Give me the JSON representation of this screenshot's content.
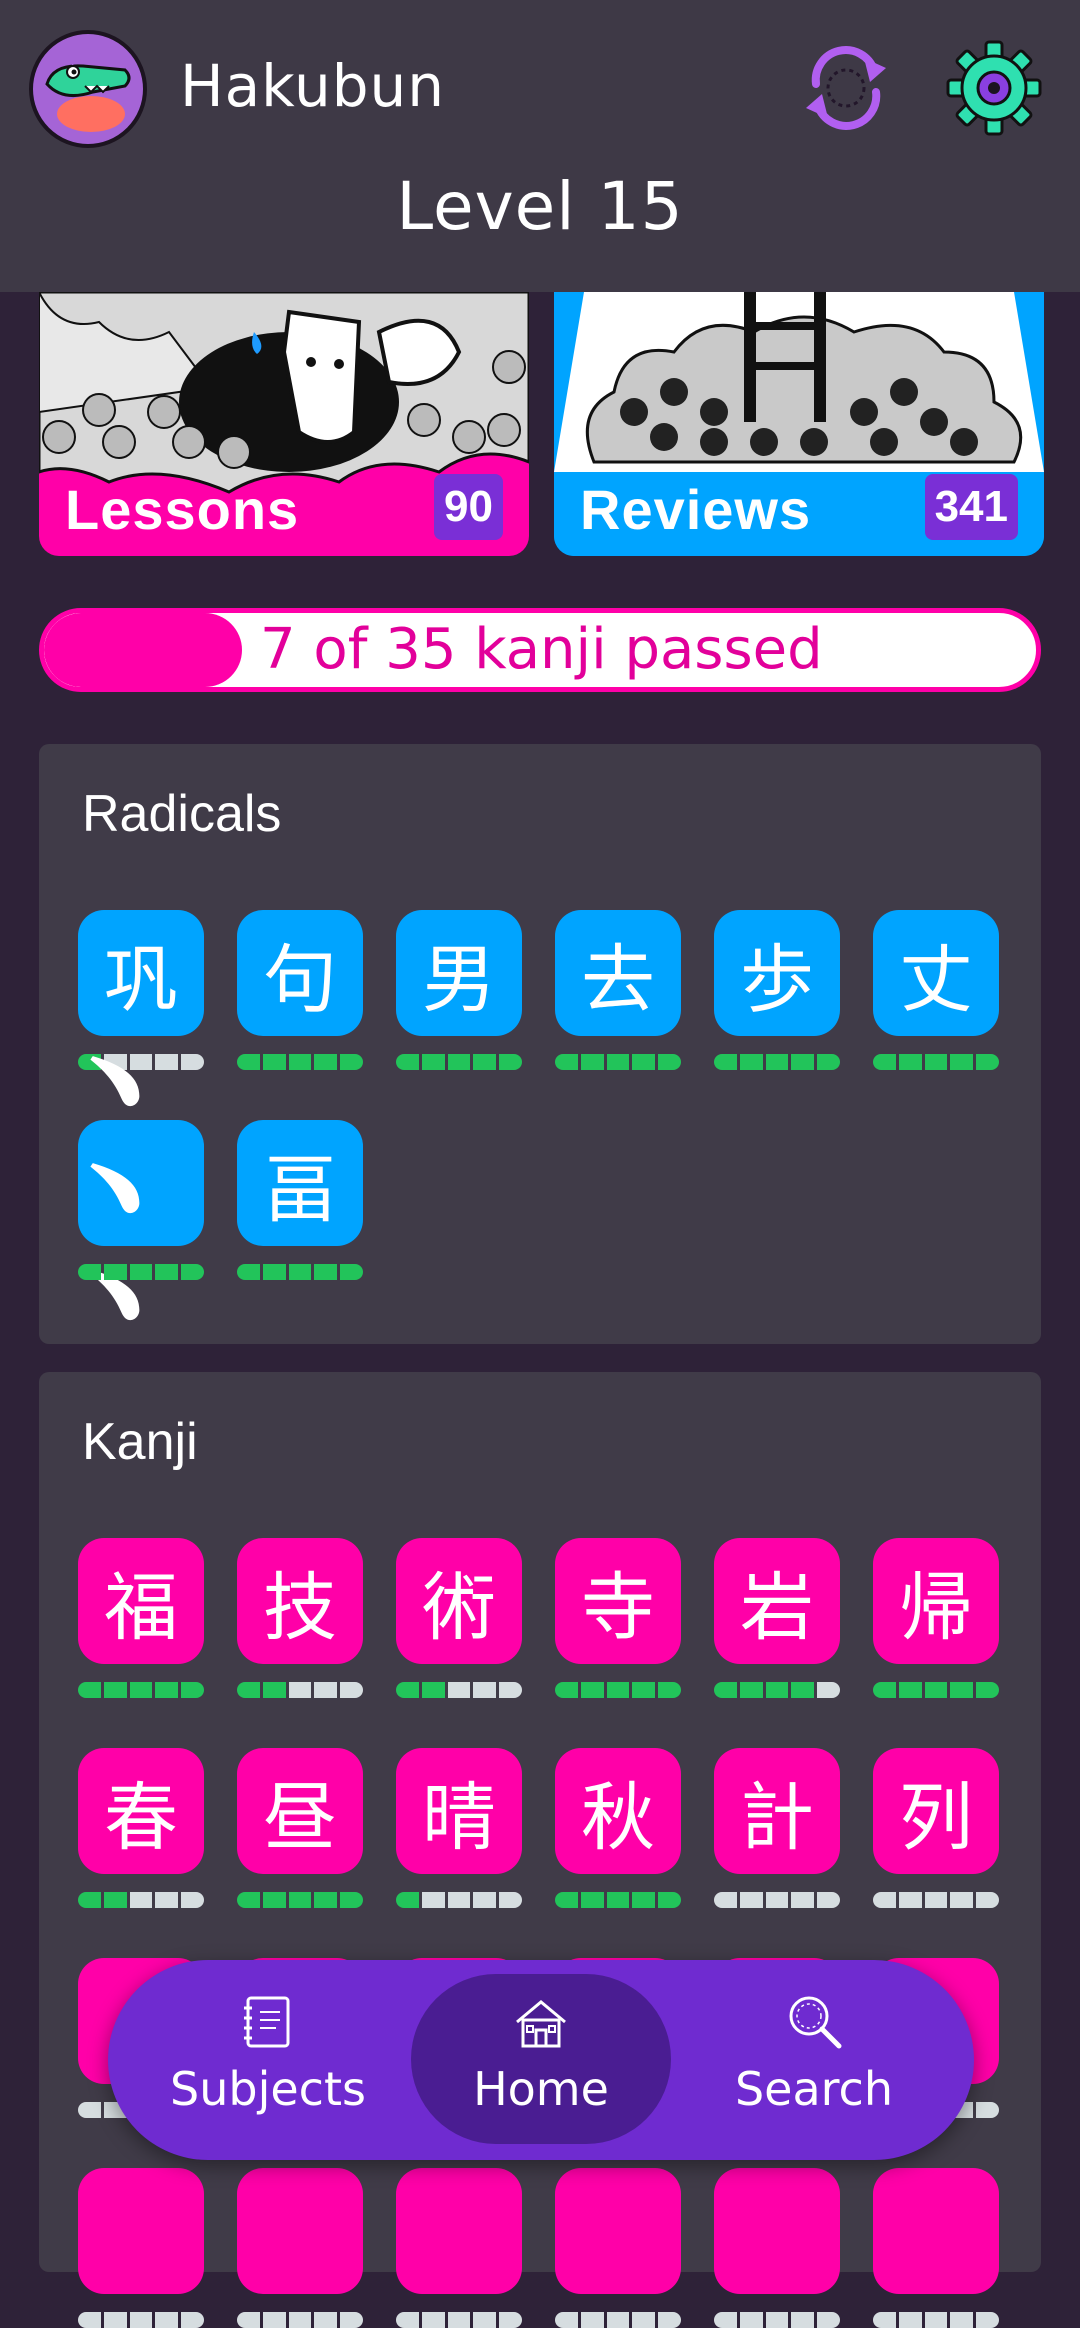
{
  "header": {
    "app_name": "Hakubun",
    "level_title": "Level 15",
    "icons": {
      "avatar": "crocodile-avatar",
      "sync": "sync-icon",
      "settings": "gear-icon"
    }
  },
  "cards": {
    "lessons": {
      "label": "Lessons",
      "count": "90"
    },
    "reviews": {
      "label": "Reviews",
      "count": "341"
    }
  },
  "progress": {
    "text": "7 of 35 kanji passed",
    "passed": 7,
    "total": 35
  },
  "radicals": {
    "title": "Radicals",
    "items": [
      {
        "char": "巩",
        "stage": 1
      },
      {
        "char": "句",
        "stage": 5
      },
      {
        "char": "男",
        "stage": 5
      },
      {
        "char": "去",
        "stage": 5
      },
      {
        "char": "歩",
        "stage": 5
      },
      {
        "char": "丈",
        "stage": 5
      },
      {
        "char": "﹅﹅﹅",
        "stage": 5
      },
      {
        "char": "畐",
        "stage": 5
      }
    ]
  },
  "kanji": {
    "title": "Kanji",
    "items": [
      {
        "char": "福",
        "stage": 5
      },
      {
        "char": "技",
        "stage": 2
      },
      {
        "char": "術",
        "stage": 2
      },
      {
        "char": "寺",
        "stage": 5
      },
      {
        "char": "岩",
        "stage": 4
      },
      {
        "char": "帰",
        "stage": 5
      },
      {
        "char": "春",
        "stage": 2
      },
      {
        "char": "昼",
        "stage": 5
      },
      {
        "char": "晴",
        "stage": 1
      },
      {
        "char": "秋",
        "stage": 5
      },
      {
        "char": "計",
        "stage": 0
      },
      {
        "char": "列",
        "stage": 0
      },
      {
        "char": "",
        "stage": 0
      },
      {
        "char": "",
        "stage": 0
      },
      {
        "char": "",
        "stage": 0
      },
      {
        "char": "",
        "stage": 0
      },
      {
        "char": "",
        "stage": 0
      },
      {
        "char": "",
        "stage": 0
      },
      {
        "char": "",
        "stage": 0
      },
      {
        "char": "",
        "stage": 0
      },
      {
        "char": "",
        "stage": 0
      },
      {
        "char": "",
        "stage": 0
      },
      {
        "char": "",
        "stage": 0
      },
      {
        "char": "",
        "stage": 0
      }
    ]
  },
  "nav": {
    "items": [
      {
        "label": "Subjects",
        "icon": "notebook-icon",
        "active": false
      },
      {
        "label": "Home",
        "icon": "house-icon",
        "active": true
      },
      {
        "label": "Search",
        "icon": "magnifier-icon",
        "active": false
      }
    ]
  },
  "colors": {
    "header_bg": "#3e3946",
    "page_bg": "#2e2238",
    "panel_bg": "#403b48",
    "pink": "#ff00a8",
    "blue": "#00a4ff",
    "purple": "#6f2bd0",
    "srs_on": "#22c45a",
    "srs_off": "#d6dde0"
  }
}
